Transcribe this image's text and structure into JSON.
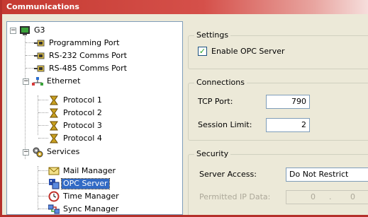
{
  "window": {
    "title": "Communications"
  },
  "tree": {
    "root": "G3",
    "programming_port": "Programming Port",
    "rs232": "RS-232 Comms Port",
    "rs485": "RS-485 Comms Port",
    "ethernet": "Ethernet",
    "protocol1": "Protocol 1",
    "protocol2": "Protocol 2",
    "protocol3": "Protocol 3",
    "protocol4": "Protocol 4",
    "services": "Services",
    "mail_manager": "Mail Manager",
    "opc_server": "OPC Server",
    "time_manager": "Time Manager",
    "sync_manager": "Sync Manager",
    "selected": "OPC Server"
  },
  "settings": {
    "legend": "Settings",
    "enable_opc_label": "Enable OPC Server",
    "enable_opc_checked": true,
    "check_mark": "✓"
  },
  "connections": {
    "legend": "Connections",
    "tcp_port_label": "TCP Port:",
    "tcp_port_value": "790",
    "session_limit_label": "Session Limit:",
    "session_limit_value": "2"
  },
  "security": {
    "legend": "Security",
    "server_access_label": "Server Access:",
    "server_access_value": "Do Not Restrict",
    "permitted_ip_label": "Permitted IP Data:",
    "ip_octet1": "0",
    "ip_octet2": "0",
    "ip_dot": "."
  },
  "colors": {
    "titlebar": "#c53a31",
    "selection": "#316ac5",
    "panel": "#ece9d8"
  }
}
